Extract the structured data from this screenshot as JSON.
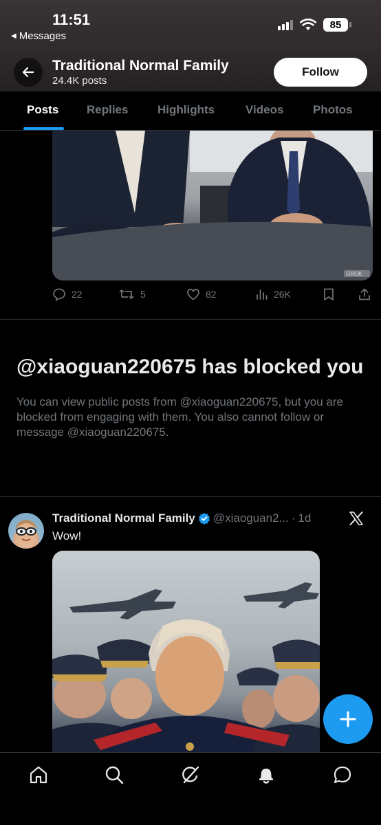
{
  "status_bar": {
    "time": "11:51",
    "back_app": "Messages",
    "battery": "85"
  },
  "profile": {
    "name": "Traditional Normal Family",
    "posts": "24.4K posts",
    "follow_label": "Follow"
  },
  "tabs": [
    {
      "label": "Posts",
      "active": true
    },
    {
      "label": "Replies"
    },
    {
      "label": "Highlights"
    },
    {
      "label": "Videos"
    },
    {
      "label": "Photos"
    }
  ],
  "post1": {
    "watermark": "GROK",
    "replies": "22",
    "reposts": "5",
    "likes": "82",
    "views": "26K"
  },
  "blocked": {
    "title": "@xiaoguan220675 has blocked you",
    "message": "You can view public posts from @xiaoguan220675, but you are blocked from engaging with them. You also cannot follow or message @xiaoguan220675."
  },
  "post2": {
    "author": "Traditional Normal Family",
    "handle": "@xiaoguan2...",
    "time": "1d",
    "text": "Wow!"
  },
  "colors": {
    "accent": "#1d9bf0",
    "muted": "#71767b",
    "divider": "#2f3336"
  },
  "icons": [
    "back-arrow-icon",
    "reply-icon",
    "repost-icon",
    "like-icon",
    "views-icon",
    "bookmark-icon",
    "share-icon",
    "verified-icon",
    "x-logo-icon",
    "compose-icon",
    "home-icon",
    "search-icon",
    "grok-icon",
    "notifications-icon",
    "messages-icon"
  ]
}
